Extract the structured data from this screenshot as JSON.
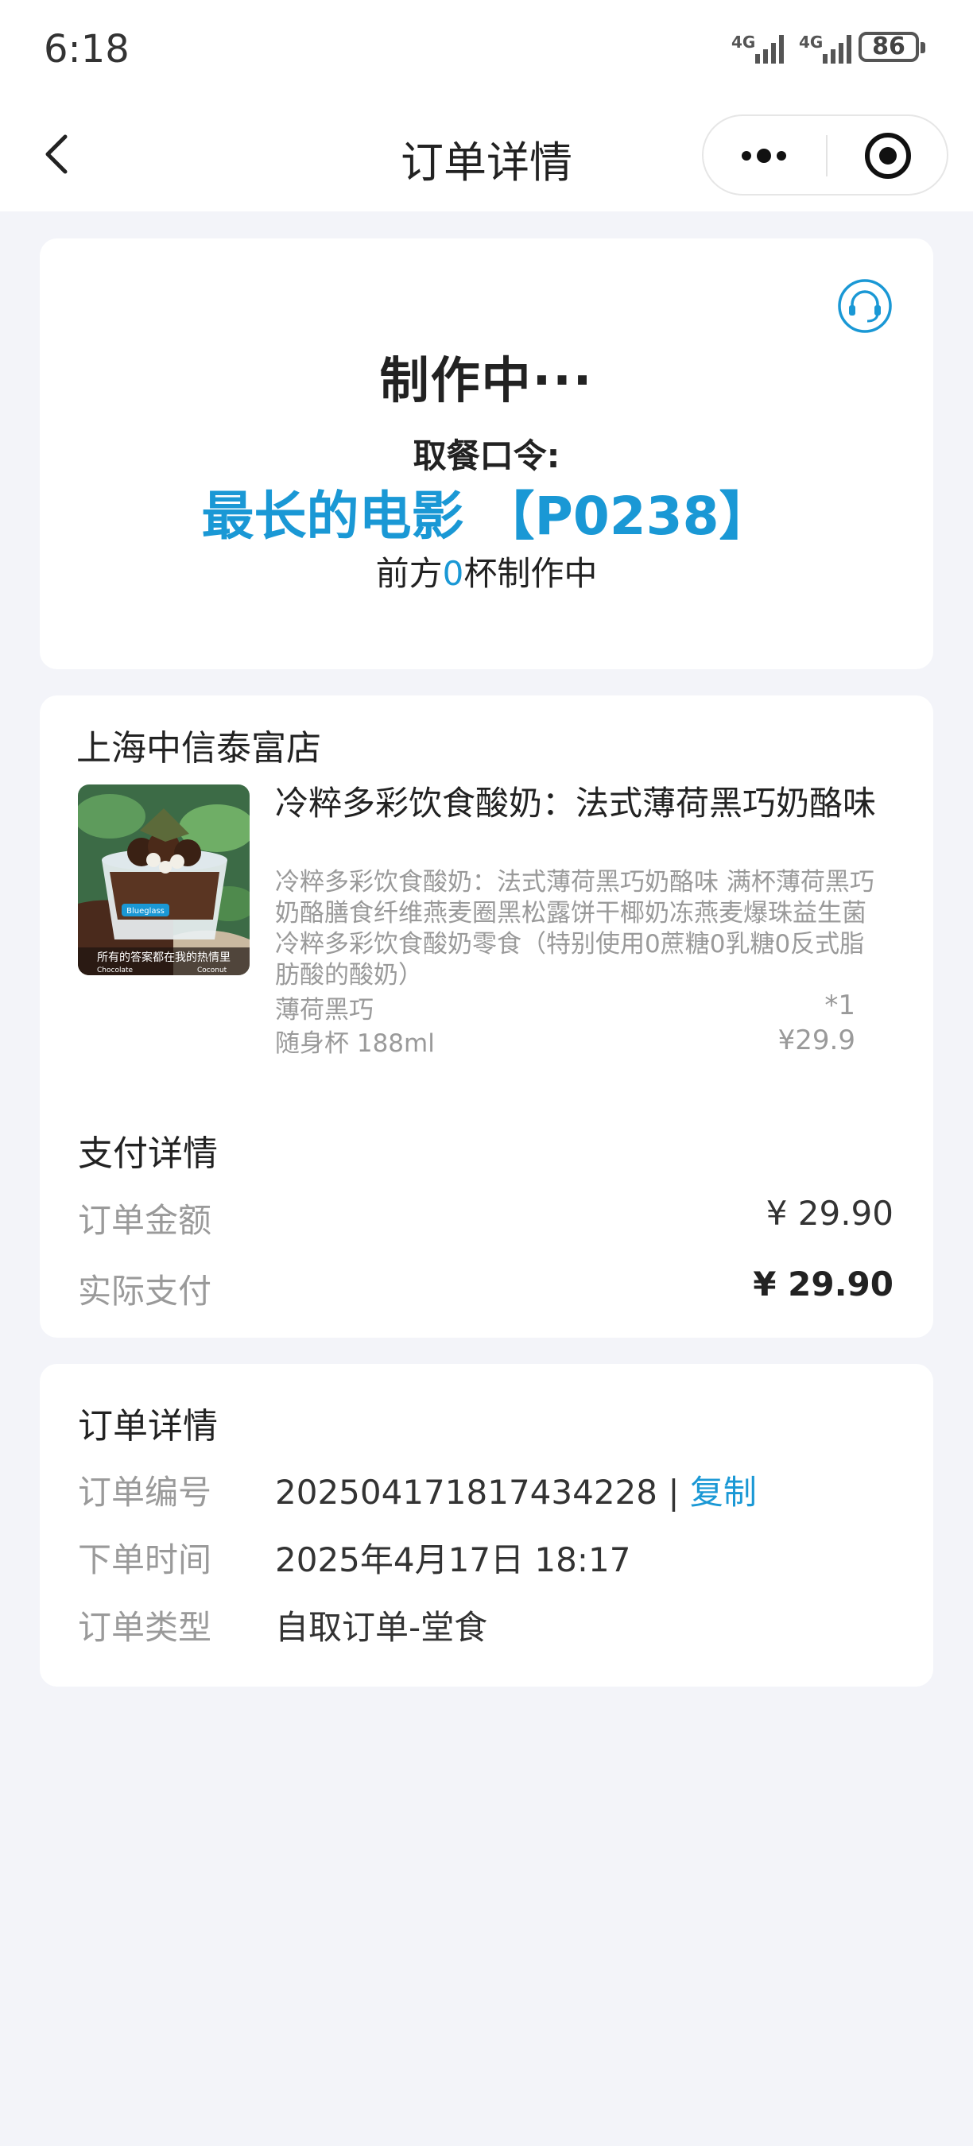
{
  "status_bar": {
    "time": "6:18",
    "network1": "4G",
    "network2": "4G",
    "battery": "86"
  },
  "nav": {
    "title": "订单详情"
  },
  "order_status": {
    "title": "制作中···",
    "pickup_label": "取餐口令:",
    "pickup_code": "最长的电影 【P0238】",
    "queue_prefix": "前方",
    "queue_count": "0",
    "queue_suffix": "杯制作中"
  },
  "store": {
    "name": "上海中信泰富店"
  },
  "product": {
    "name": "冷粹多彩饮食酸奶：法式薄荷黑巧奶酪味",
    "description": "冷粹多彩饮食酸奶：法式薄荷黑巧奶酪味 满杯薄荷黑巧奶酪膳食纤维燕麦圈黑松露饼干椰奶冻燕麦爆珠益生菌冷粹多彩饮食酸奶零食（特别使用0蔗糖0乳糖0反式脂肪酸的酸奶）",
    "option1": "薄荷黑巧",
    "option2": "随身杯 188ml",
    "quantity": "*1",
    "price": "¥29.9",
    "image_text": {
      "brand": "Blueglass",
      "slogan": "所有的答案都在我的热情里",
      "label_left": "Chocolate",
      "label_right": "Coconut"
    }
  },
  "payment": {
    "title": "支付详情",
    "order_amount_label": "订单金额",
    "order_amount": "¥ 29.90",
    "actual_paid_label": "实际支付",
    "actual_paid": "¥ 29.90"
  },
  "order_info": {
    "title": "订单详情",
    "order_no_label": "订单编号",
    "order_no": "202504171817434228",
    "separator": "|",
    "copy_label": "复制",
    "time_label": "下单时间",
    "time": "2025年4月17日 18:17",
    "type_label": "订单类型",
    "type": "自取订单-堂食"
  },
  "colors": {
    "accent": "#1a98d5",
    "background": "#f3f4f9"
  }
}
